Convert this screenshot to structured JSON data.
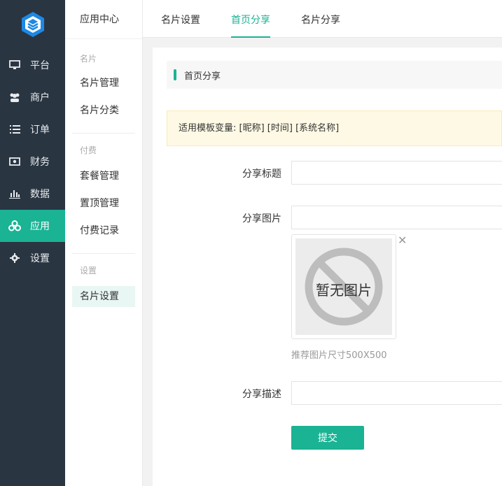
{
  "nav": {
    "items": [
      {
        "label": "平台",
        "icon": "monitor-icon"
      },
      {
        "label": "商户",
        "icon": "users-icon"
      },
      {
        "label": "订单",
        "icon": "list-icon"
      },
      {
        "label": "财务",
        "icon": "money-icon"
      },
      {
        "label": "数据",
        "icon": "bar-chart-icon"
      },
      {
        "label": "应用",
        "icon": "cubes-icon",
        "active": true
      },
      {
        "label": "设置",
        "icon": "gear-icon"
      }
    ]
  },
  "submenu": {
    "title": "应用中心",
    "groups": [
      {
        "label": "名片",
        "items": [
          "名片管理",
          "名片分类"
        ]
      },
      {
        "label": "付费",
        "items": [
          "套餐管理",
          "置顶管理",
          "付费记录"
        ]
      },
      {
        "label": "设置",
        "items": [
          "名片设置"
        ]
      }
    ]
  },
  "tabs": [
    "名片设置",
    "首页分享",
    "名片分享"
  ],
  "section": {
    "title": "首页分享"
  },
  "tip": "适用模板变量: [昵称] [时间] [系统名称]",
  "form": {
    "title_label": "分享标题",
    "title_value": "",
    "image_label": "分享图片",
    "image_value": "",
    "image_placeholder_text": "暂无图片",
    "image_hint": "推荐图片尺寸500X500",
    "desc_label": "分享描述",
    "desc_value": "",
    "submit_label": "提交"
  },
  "colors": {
    "accent": "#1ab394",
    "nav_bg": "#2a3542",
    "tip_bg": "#fef9e4"
  }
}
